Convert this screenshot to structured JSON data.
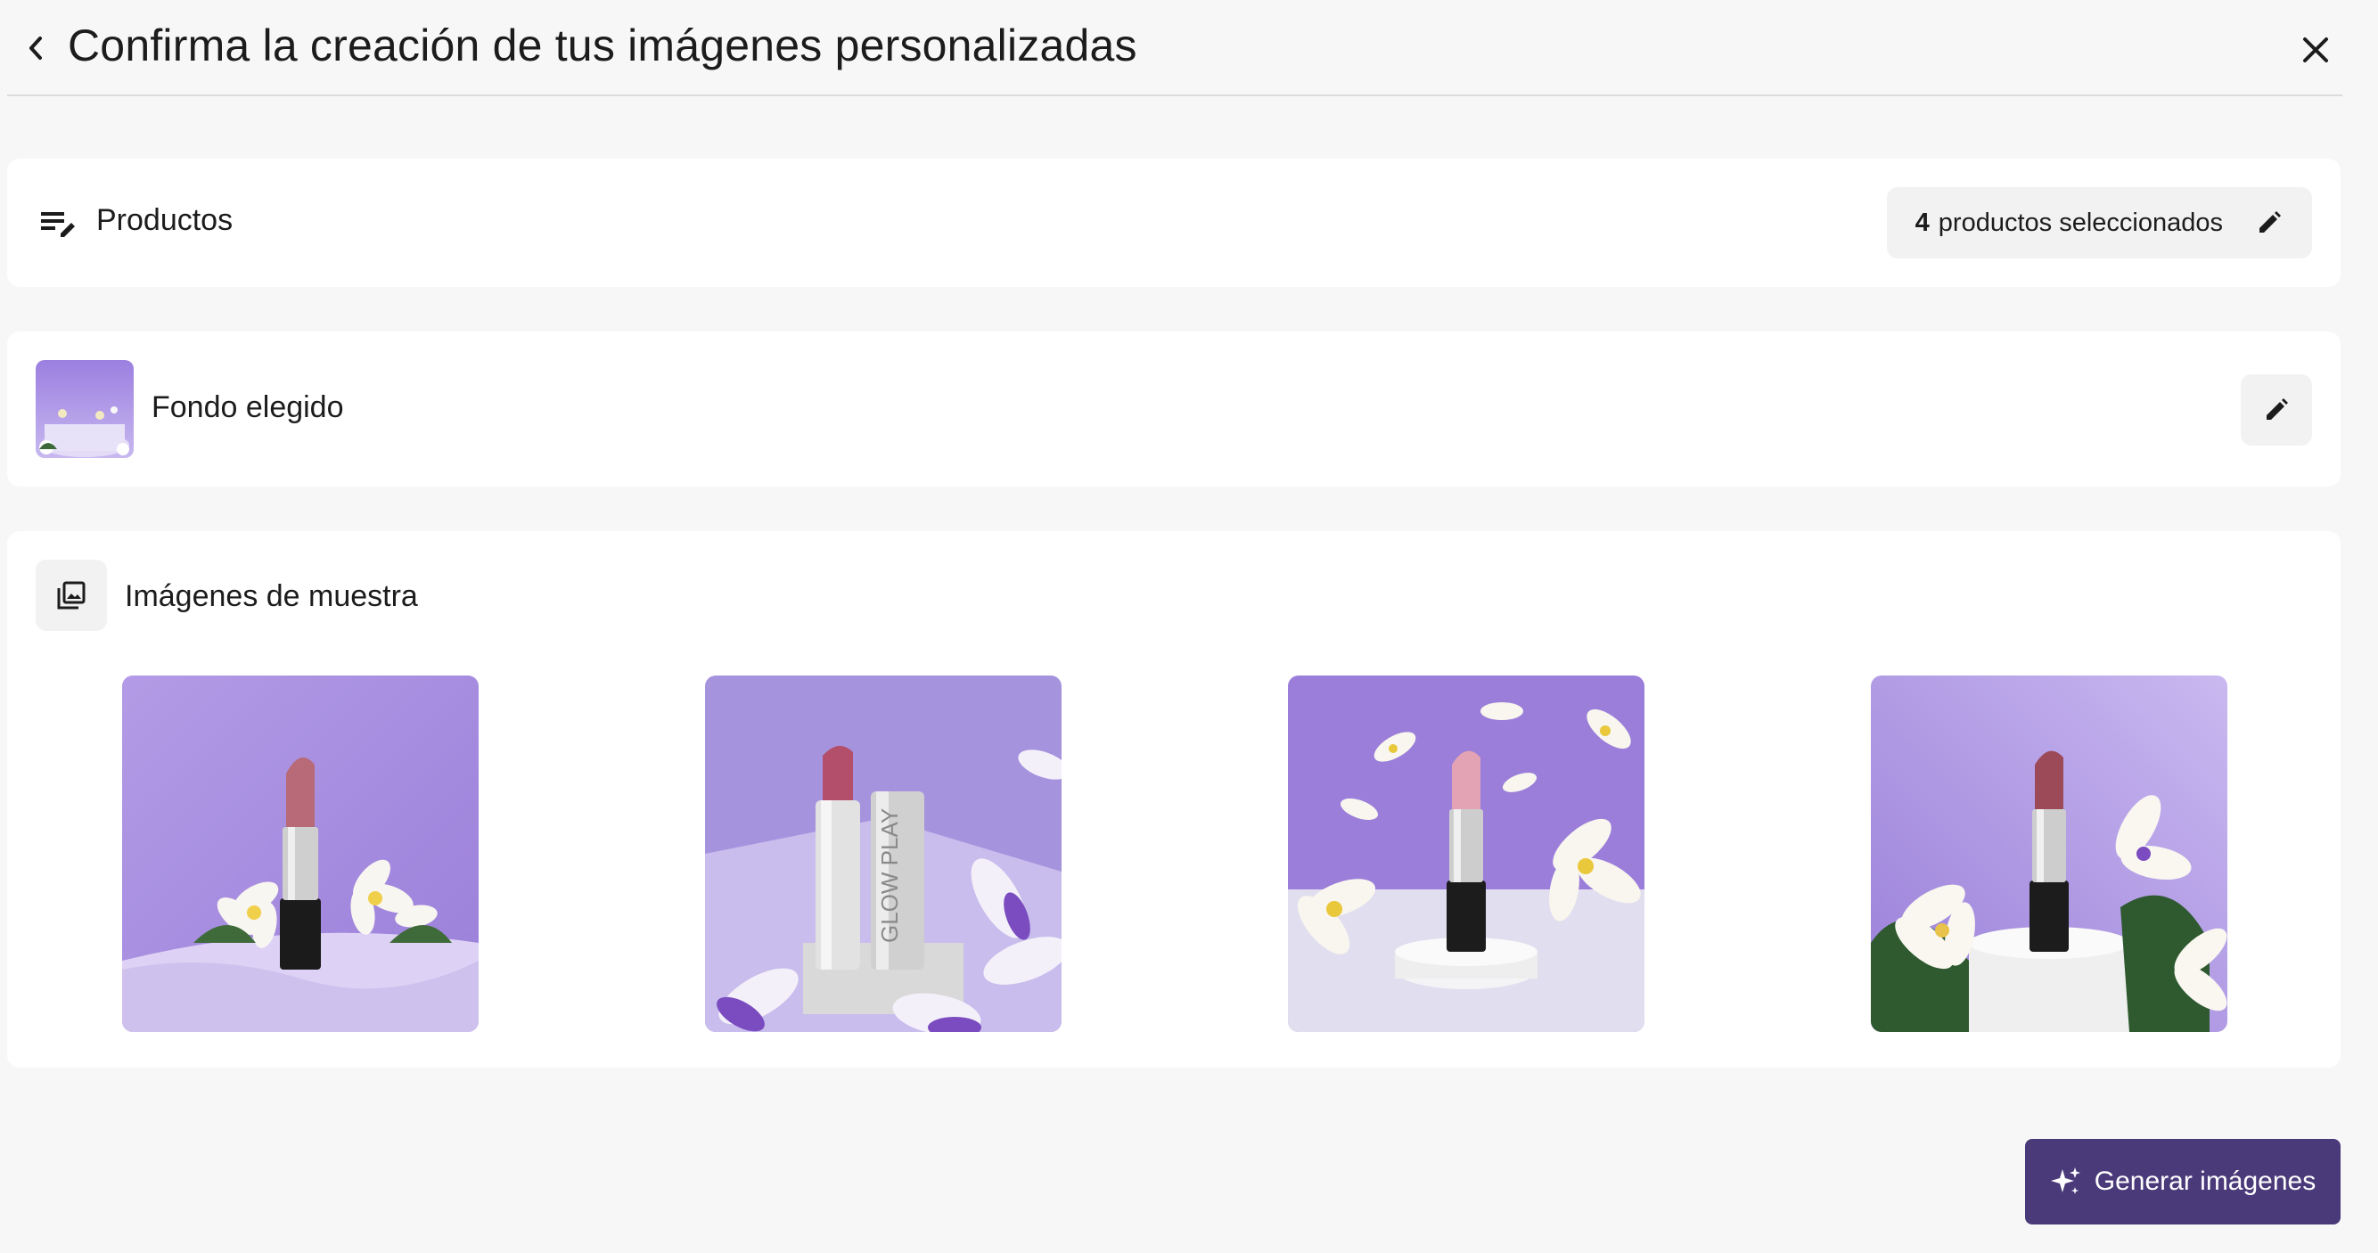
{
  "header": {
    "title": "Confirma la creación de tus imágenes personalizadas",
    "back_icon": "chevron-left-icon",
    "close_icon": "close-icon"
  },
  "products": {
    "label": "Productos",
    "icon": "edit-list-icon",
    "selected_count": "4",
    "selected_text": "productos seleccionados",
    "edit_icon": "pencil-icon"
  },
  "background": {
    "label": "Fondo elegido",
    "edit_icon": "pencil-icon"
  },
  "samples": {
    "label": "Imágenes de muestra",
    "icon": "image-gallery-icon",
    "images": [
      {
        "product": "lipstick-rose"
      },
      {
        "product": "lipstick-glow-play"
      },
      {
        "product": "lipstick-pink"
      },
      {
        "product": "lipstick-mauve"
      }
    ],
    "glow_play_text": "GLOW PLAY"
  },
  "actions": {
    "generate_label": "Generar imágenes",
    "generate_icon": "sparkle-icon"
  },
  "colors": {
    "accent": "#4a3a7a",
    "background": "#f7f7f7",
    "card": "#ffffff",
    "purple_backdrop": "#a892e0"
  }
}
